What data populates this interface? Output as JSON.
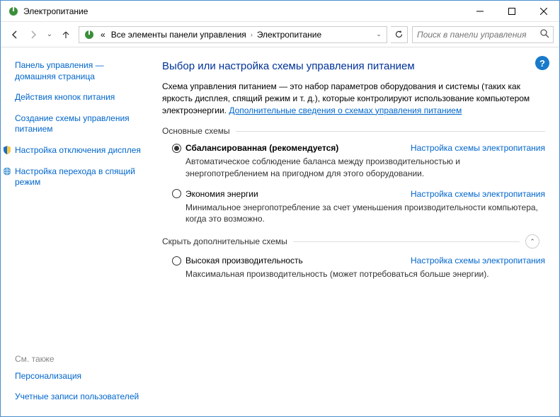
{
  "window": {
    "title": "Электропитание"
  },
  "breadcrumb": {
    "seg1": "Все элементы панели управления",
    "seg2": "Электропитание",
    "prefix": "«"
  },
  "search": {
    "placeholder": "Поиск в панели управления"
  },
  "sidebar": {
    "home": "Панель управления — домашняя страница",
    "links": [
      "Действия кнопок питания",
      "Создание схемы управления питанием",
      "Настройка отключения дисплея",
      "Настройка перехода в спящий режим"
    ],
    "see_also": "См. также",
    "extra": [
      "Персонализация",
      "Учетные записи пользователей"
    ]
  },
  "main": {
    "heading": "Выбор или настройка схемы управления питанием",
    "desc_pre": "Схема управления питанием — это набор параметров оборудования и системы (таких как яркость дисплея, спящий режим и т. д.), которые контролируют использование компьютером электроэнергии. ",
    "desc_link": "Дополнительные сведения о схемах управления питанием",
    "section1": "Основные схемы",
    "section2": "Скрыть дополнительные схемы",
    "plans": [
      {
        "name": "Сбалансированная (рекомендуется)",
        "desc": "Автоматическое соблюдение баланса между производительностью и энергопотреблением на пригодном для этого оборудовании.",
        "selected": true,
        "link": "Настройка схемы электропитания"
      },
      {
        "name": "Экономия энергии",
        "desc": "Минимальное энергопотребление за счет уменьшения производительности компьютера, когда это возможно.",
        "selected": false,
        "link": "Настройка схемы электропитания"
      }
    ],
    "extra_plans": [
      {
        "name": "Высокая производительность",
        "desc": "Максимальная производительность (может потребоваться больше энергии).",
        "selected": false,
        "link": "Настройка схемы электропитания"
      }
    ]
  }
}
